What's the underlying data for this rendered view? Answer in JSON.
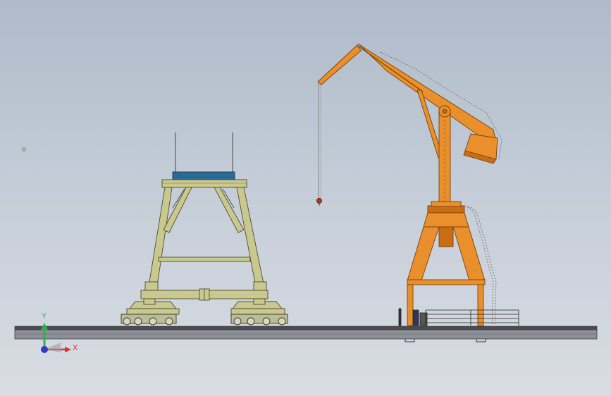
{
  "triad": {
    "y_label": "Y",
    "x_label": "X",
    "y_color": "#2db34a",
    "x_color": "#e0302a",
    "z_color": "#2f3bc9"
  },
  "colors": {
    "gantry_frame": "#c9c98f",
    "gantry_outline": "#4d4d2e",
    "gantry_top_plate": "#2a6a95",
    "crane_body": "#e9902c",
    "crane_dark": "#c96d12",
    "crane_outline": "#7a4008",
    "rail": "#8d9097",
    "rail_outline": "#3b3b40"
  }
}
